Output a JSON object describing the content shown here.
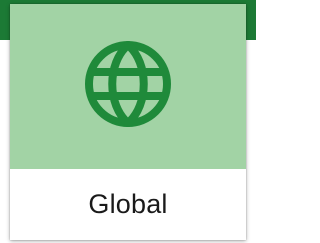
{
  "card": {
    "label": "Global",
    "icon": "globe-icon"
  },
  "colors": {
    "header_bar": "#1c7a35",
    "card_media_bg": "#a2d3a5",
    "icon": "#1f8a3a",
    "label_text": "#1a1a1a"
  }
}
